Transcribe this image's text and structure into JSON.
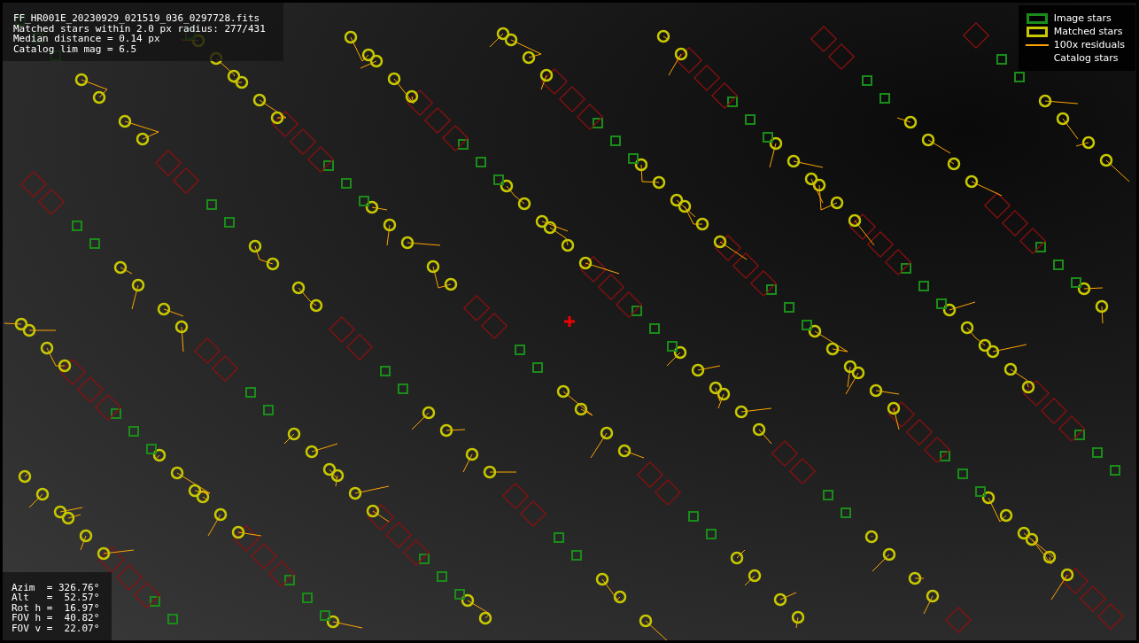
{
  "image": {
    "file_info": [
      "FF_HR001E_20230929_021519_036_0297728.fits",
      "Matched stars within 2.0 px radius: 277/431",
      "Median distance = 0.14 px",
      "Catalog lim mag = 6.5"
    ],
    "legend": [
      {
        "kind": "image",
        "label": "Image stars"
      },
      {
        "kind": "matched",
        "label": "Matched stars"
      },
      {
        "kind": "residual",
        "label": "100x residuals"
      },
      {
        "kind": "catalog",
        "label": "Catalog stars"
      }
    ],
    "pointing": [
      "Azim  = 326.76°",
      "Alt   =  52.57°",
      "Rot h =  16.97°",
      "FOV h =  40.82°",
      "FOV v =  22.07°"
    ]
  }
}
